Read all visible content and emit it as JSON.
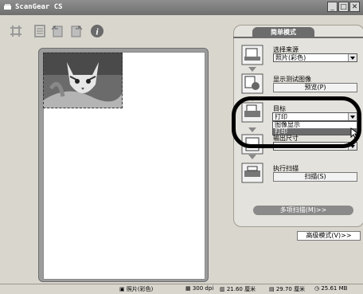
{
  "window": {
    "title": "ScanGear CS"
  },
  "panel": {
    "mode_tab": "简单模式",
    "steps": [
      {
        "label": "选择来源",
        "value": "照片(彩色)"
      },
      {
        "label": "显示测试图像",
        "button": "预览(P)"
      },
      {
        "label": "目标",
        "value": "打印",
        "options": [
          "图像显示",
          "打印"
        ],
        "highlighted_option": "打印"
      },
      {
        "label": "输出尺寸"
      },
      {
        "label": "执行扫描",
        "button": "扫描(S)"
      }
    ],
    "multi_scan_button": "多项扫描(M)>>",
    "advanced_mode_button": "高级模式(V)>>"
  },
  "status": {
    "color_mode": "照片(彩色)",
    "resolution": "300 dpi",
    "width": "21.60 厘米",
    "height": "29.70 厘米",
    "file_size": "25.61 MB"
  },
  "colors": {
    "highlight_ring": "#000000",
    "tab_bg": "#6c6c6c"
  }
}
